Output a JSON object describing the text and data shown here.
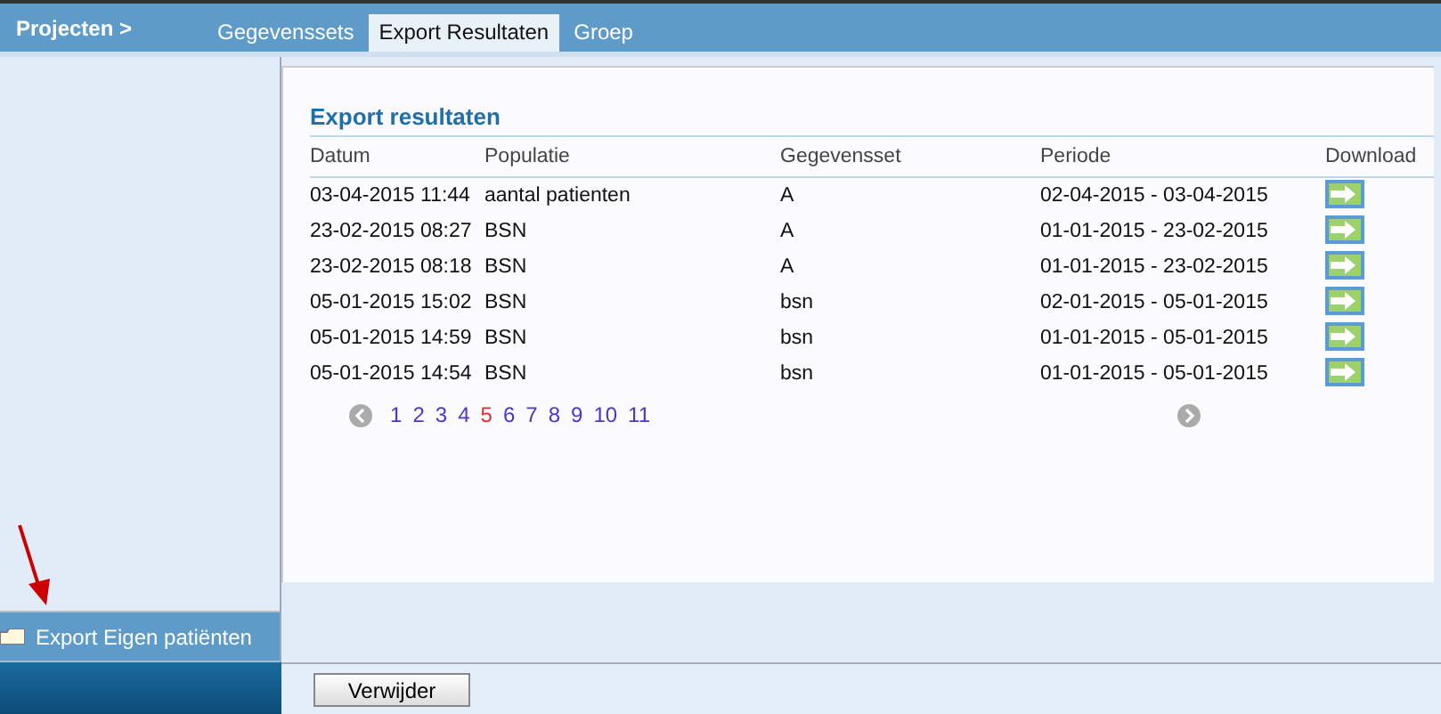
{
  "breadcrumb": "Projecten >",
  "tabs": [
    {
      "label": "Gegevenssets",
      "selected": false
    },
    {
      "label": "Export Resultaten",
      "selected": true
    },
    {
      "label": "Groep",
      "selected": false
    }
  ],
  "sidebar": {
    "items": [
      {
        "label": "Export Eigen patiënten",
        "selected": true
      }
    ]
  },
  "panel": {
    "title": "Export resultaten",
    "columns": [
      "Datum",
      "Populatie",
      "Gegevensset",
      "Periode",
      "Download"
    ],
    "rows": [
      {
        "datum": "03-04-2015 11:44",
        "populatie": "aantal patienten",
        "gegevensset": "A",
        "periode": "02-04-2015 - 03-04-2015"
      },
      {
        "datum": "23-02-2015 08:27",
        "populatie": "BSN",
        "gegevensset": "A",
        "periode": "01-01-2015 - 23-02-2015"
      },
      {
        "datum": "23-02-2015 08:18",
        "populatie": "BSN",
        "gegevensset": "A",
        "periode": "01-01-2015 - 23-02-2015"
      },
      {
        "datum": "05-01-2015 15:02",
        "populatie": "BSN",
        "gegevensset": "bsn",
        "periode": "02-01-2015 - 05-01-2015"
      },
      {
        "datum": "05-01-2015 14:59",
        "populatie": "BSN",
        "gegevensset": "bsn",
        "periode": "01-01-2015 - 05-01-2015"
      },
      {
        "datum": "05-01-2015 14:54",
        "populatie": "BSN",
        "gegevensset": "bsn",
        "periode": "01-01-2015 - 05-01-2015"
      }
    ],
    "pages": [
      {
        "label": "1",
        "selected": false
      },
      {
        "label": "2",
        "selected": false
      },
      {
        "label": "3",
        "selected": false
      },
      {
        "label": "4",
        "selected": false
      },
      {
        "label": "5",
        "selected": true
      },
      {
        "label": "6",
        "selected": false
      },
      {
        "label": "7",
        "selected": false
      },
      {
        "label": "8",
        "selected": false
      },
      {
        "label": "9",
        "selected": false
      },
      {
        "label": "10",
        "selected": false
      },
      {
        "label": "11",
        "selected": false
      }
    ]
  },
  "buttons": [
    "Verwijder"
  ]
}
